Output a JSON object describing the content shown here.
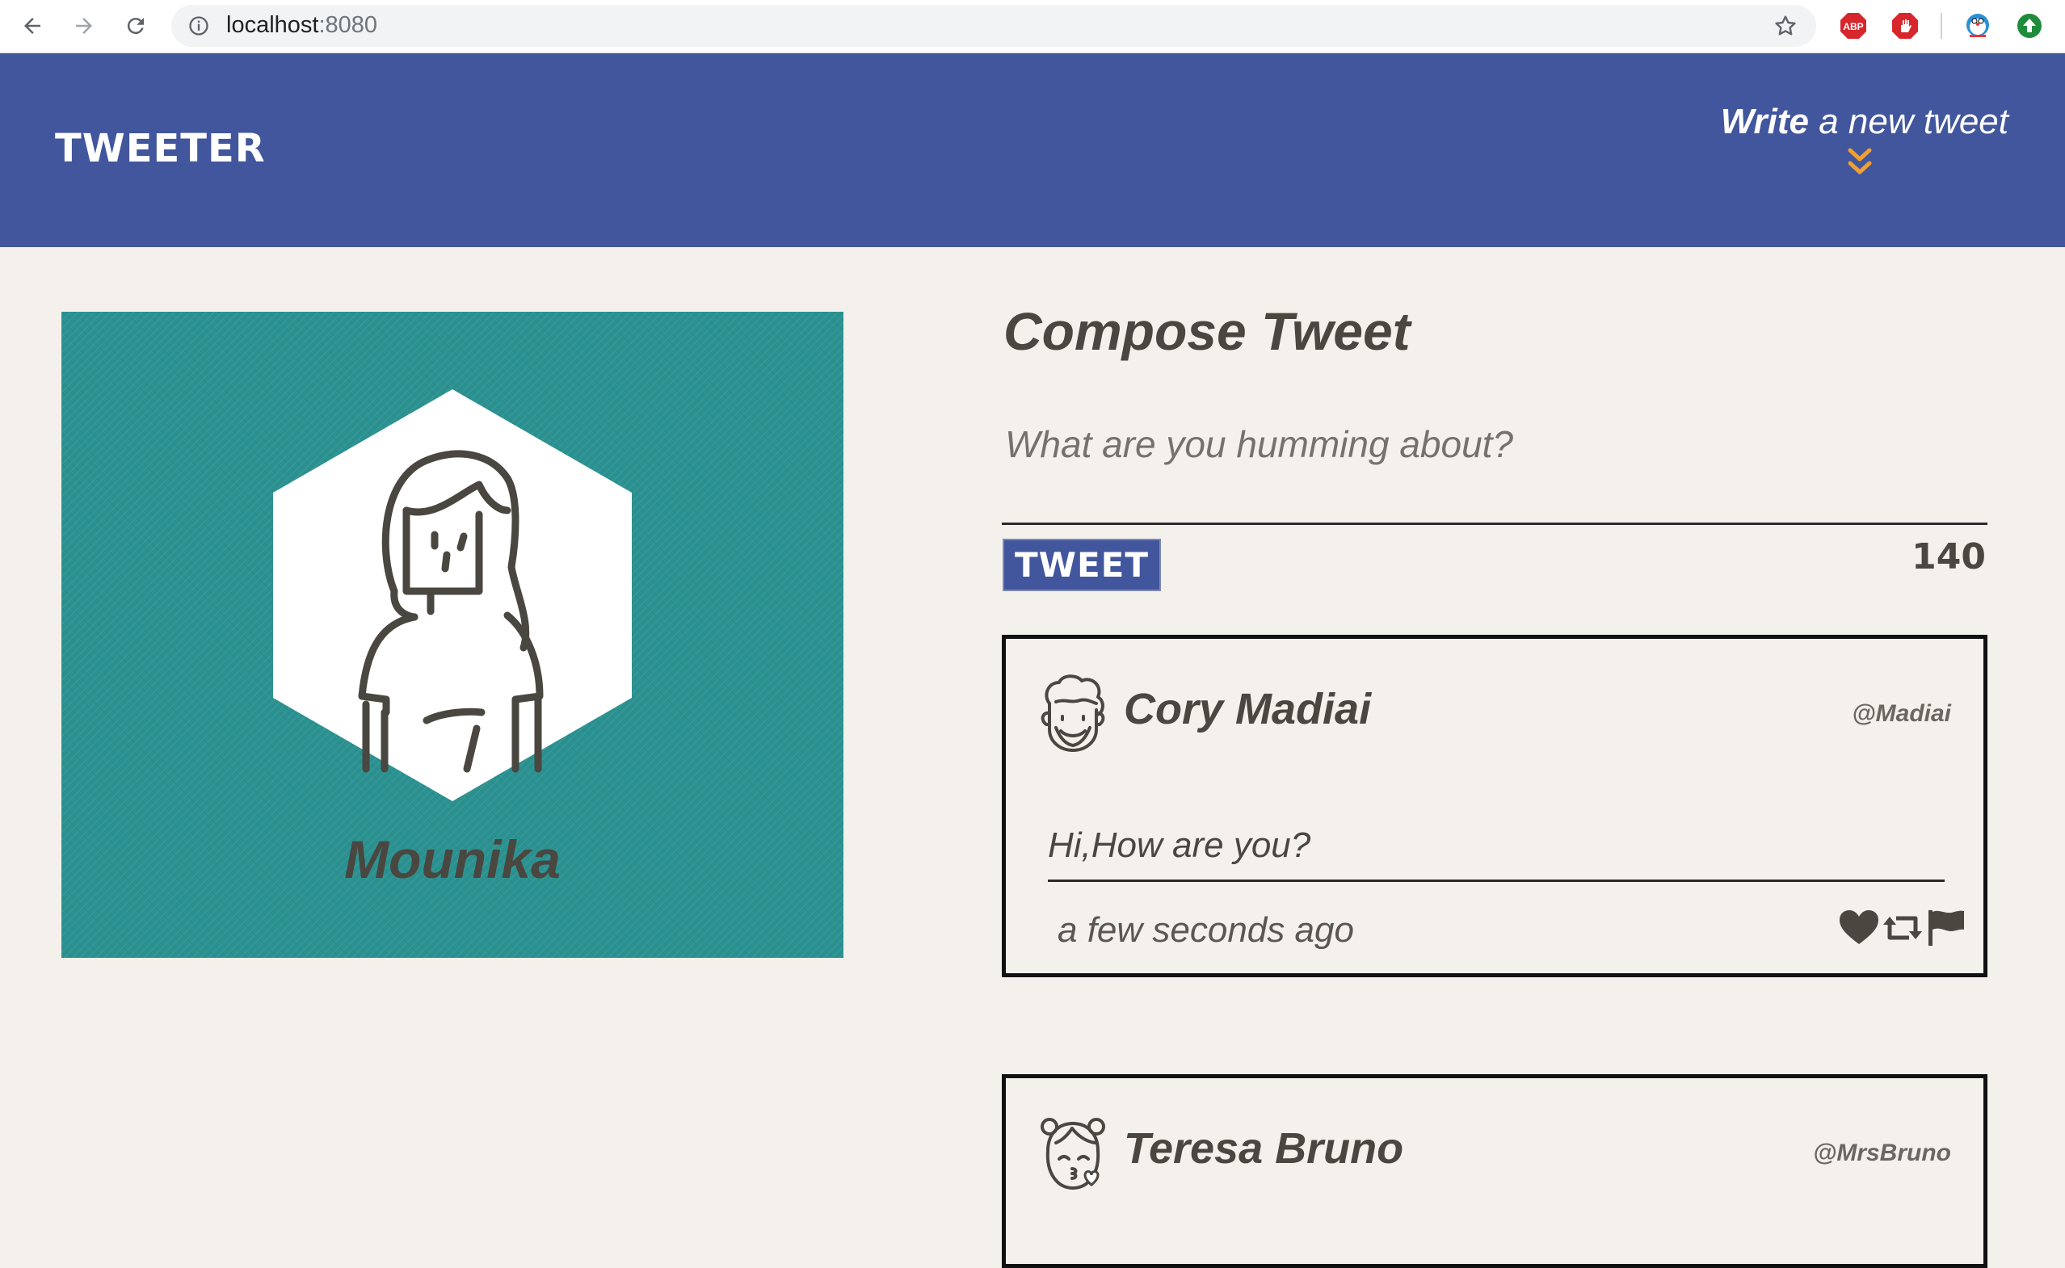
{
  "browser": {
    "url_host": "localhost",
    "url_port": ":8080",
    "extensions": [
      "adblock-icon",
      "stop-hand-icon",
      "doraemon-icon",
      "upload-arrow-icon"
    ]
  },
  "header": {
    "logo": "TWEETER",
    "compose_toggle": {
      "bold": "Write",
      "rest": " a new tweet"
    },
    "colors": {
      "bar": "#42569d",
      "chevron": "#f0a030"
    }
  },
  "profile": {
    "name": "Mounika",
    "card_color": "#2a9190"
  },
  "compose": {
    "title": "Compose Tweet",
    "placeholder": "What are you humming about?",
    "button_label": "TWEET",
    "counter": "140"
  },
  "tweets": [
    {
      "author": "Cory Madiai",
      "handle": "@Madiai",
      "content": "Hi,How are you?",
      "time": "a few seconds ago",
      "avatar_icon": "curly-hair-man-avatar-icon"
    },
    {
      "author": "Teresa Bruno",
      "handle": "@MrsBruno",
      "avatar_icon": "kissing-girl-avatar-icon"
    }
  ]
}
